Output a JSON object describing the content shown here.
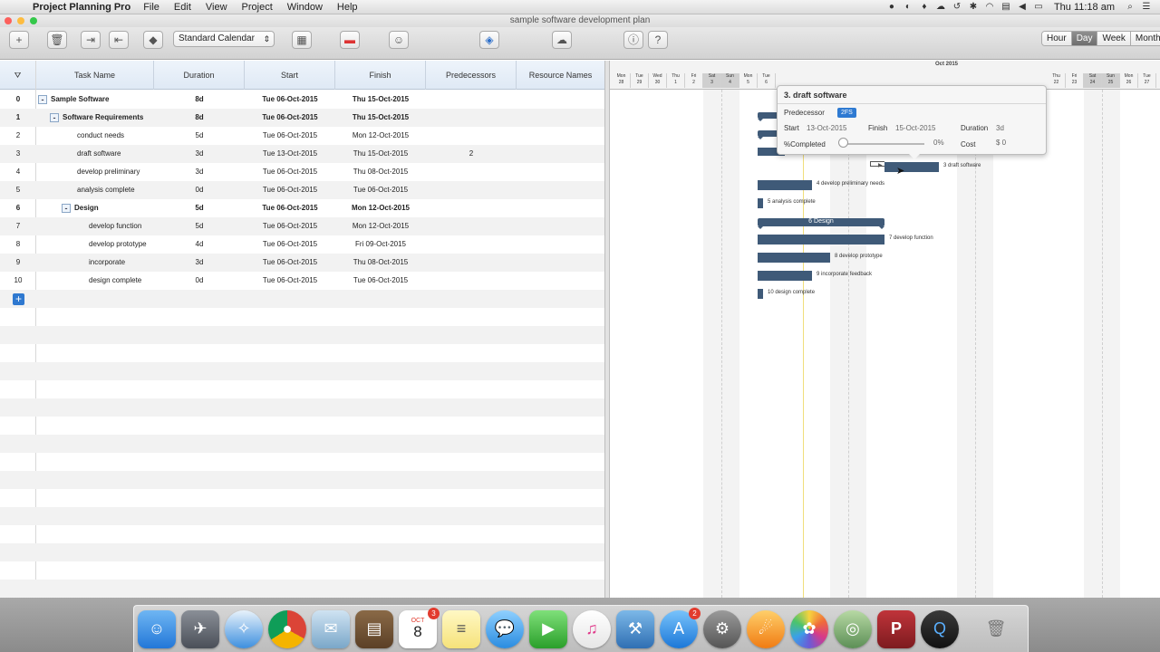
{
  "menubar": {
    "app_name": "Project Planning Pro",
    "items": [
      "File",
      "Edit",
      "View",
      "Project",
      "Window",
      "Help"
    ],
    "clock": "Thu 11:18 am"
  },
  "window": {
    "title": "sample software development plan"
  },
  "toolbar": {
    "calendar_value": "Standard Calendar",
    "scale_options": [
      "Hour",
      "Day",
      "Week",
      "Month"
    ],
    "scale_selected": "Day"
  },
  "grid": {
    "columns": [
      "Task Name",
      "Duration",
      "Start",
      "Finish",
      "Predecessors",
      "Resource Names"
    ],
    "rows": [
      {
        "id": "0",
        "name": "Sample Software",
        "duration": "8d",
        "start": "Tue 06-Oct-2015",
        "finish": "Thu 15-Oct-2015",
        "pred": ""
      },
      {
        "id": "1",
        "name": "Software Requirements",
        "duration": "8d",
        "start": "Tue 06-Oct-2015",
        "finish": "Thu 15-Oct-2015",
        "pred": ""
      },
      {
        "id": "2",
        "name": "conduct needs",
        "duration": "5d",
        "start": "Tue 06-Oct-2015",
        "finish": "Mon 12-Oct-2015",
        "pred": ""
      },
      {
        "id": "3",
        "name": "draft software",
        "duration": "3d",
        "start": "Tue 13-Oct-2015",
        "finish": "Thu 15-Oct-2015",
        "pred": "2"
      },
      {
        "id": "4",
        "name": "develop preliminary",
        "duration": "3d",
        "start": "Tue 06-Oct-2015",
        "finish": "Thu 08-Oct-2015",
        "pred": ""
      },
      {
        "id": "5",
        "name": "analysis complete",
        "duration": "0d",
        "start": "Tue 06-Oct-2015",
        "finish": "Tue 06-Oct-2015",
        "pred": ""
      },
      {
        "id": "6",
        "name": "Design",
        "duration": "5d",
        "start": "Tue 06-Oct-2015",
        "finish": "Mon 12-Oct-2015",
        "pred": ""
      },
      {
        "id": "7",
        "name": "develop function",
        "duration": "5d",
        "start": "Tue 06-Oct-2015",
        "finish": "Mon 12-Oct-2015",
        "pred": ""
      },
      {
        "id": "8",
        "name": "develop prototype",
        "duration": "4d",
        "start": "Tue 06-Oct-2015",
        "finish": "Fri 09-Oct-2015",
        "pred": ""
      },
      {
        "id": "9",
        "name": "incorporate",
        "duration": "3d",
        "start": "Tue 06-Oct-2015",
        "finish": "Thu 08-Oct-2015",
        "pred": ""
      },
      {
        "id": "10",
        "name": "design complete",
        "duration": "0d",
        "start": "Tue 06-Oct-2015",
        "finish": "Tue 06-Oct-2015",
        "pred": ""
      }
    ]
  },
  "gantt": {
    "month_label": "Oct 2015",
    "days_left": [
      {
        "dow": "Mon",
        "d": "28"
      },
      {
        "dow": "Tue",
        "d": "29"
      },
      {
        "dow": "Wed",
        "d": "30"
      },
      {
        "dow": "Thu",
        "d": "1"
      },
      {
        "dow": "Fri",
        "d": "2"
      },
      {
        "dow": "Sat",
        "d": "3"
      },
      {
        "dow": "Sun",
        "d": "4"
      },
      {
        "dow": "Mon",
        "d": "5"
      },
      {
        "dow": "Tue",
        "d": "6"
      }
    ],
    "days_right": [
      {
        "dow": "Thu",
        "d": "22"
      },
      {
        "dow": "Fri",
        "d": "23"
      },
      {
        "dow": "Sat",
        "d": "24"
      },
      {
        "dow": "Sun",
        "d": "25"
      },
      {
        "dow": "Mon",
        "d": "26"
      },
      {
        "dow": "Tue",
        "d": "27"
      }
    ],
    "bar_labels": {
      "t3": "3 draft software",
      "t4": "4 develop preliminary needs",
      "t5": "5 analysis complete",
      "t6": "6 Design",
      "t7": "7 develop function",
      "t8": "8 develop prototype",
      "t9": "9 incorporate feedback",
      "t10": "10 design complete"
    }
  },
  "popover": {
    "title": "3. draft software",
    "predecessor_label": "Predecessor",
    "predecessor_value": "2FS",
    "start_label": "Start",
    "start_value": "13-Oct-2015",
    "finish_label": "Finish",
    "finish_value": "15-Oct-2015",
    "duration_label": "Duration",
    "duration_value": "3d",
    "completed_label": "%Completed",
    "completed_value": "0%",
    "cost_label": "Cost",
    "cost_value": "$ 0"
  },
  "dock": {
    "badges": {
      "calendar": "3",
      "appstore": "2"
    },
    "calendar_month": "OCT",
    "calendar_day": "8"
  },
  "colors": {
    "bar": "#3f5a78",
    "accent": "#2e7ad2"
  }
}
